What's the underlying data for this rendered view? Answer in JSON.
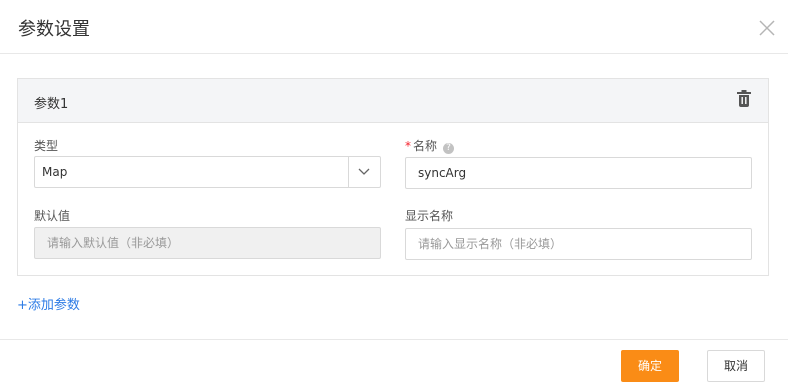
{
  "dialog": {
    "title": "参数设置",
    "close_icon": "close-icon"
  },
  "param": {
    "title": "参数1",
    "delete_icon": "trash-icon",
    "type_label": "类型",
    "type_value": "Map",
    "name_required_mark": "*",
    "name_label": "名称",
    "name_help": "?",
    "name_value": "syncArg",
    "default_label": "默认值",
    "default_placeholder": "请输入默认值（非必填）",
    "display_label": "显示名称",
    "display_placeholder": "请输入显示名称（非必填）"
  },
  "actions": {
    "add_param": "+添加参数",
    "ok": "确定",
    "cancel": "取消"
  },
  "colors": {
    "primary": "#fa8c16",
    "link": "#2c7be5",
    "required": "#f5222d",
    "panel_header": "#f4f5f7"
  }
}
